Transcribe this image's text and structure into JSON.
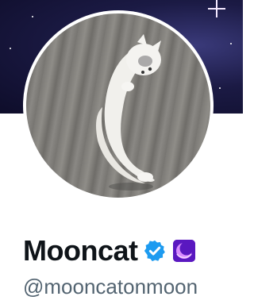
{
  "profile": {
    "display_name": "Mooncat",
    "handle": "@mooncatonmoon",
    "verified": true,
    "verified_icon": "verified-check-icon",
    "affiliate_badge_icon": "crescent-moon-badge-icon",
    "avatar_alt": "white cat curled like a crescent moon",
    "banner": "starry night sky"
  },
  "colors": {
    "name_text": "#0f1419",
    "handle_text": "#536471",
    "verified_blue": "#1d9bf0",
    "badge_purple": "#6a1fd0"
  }
}
